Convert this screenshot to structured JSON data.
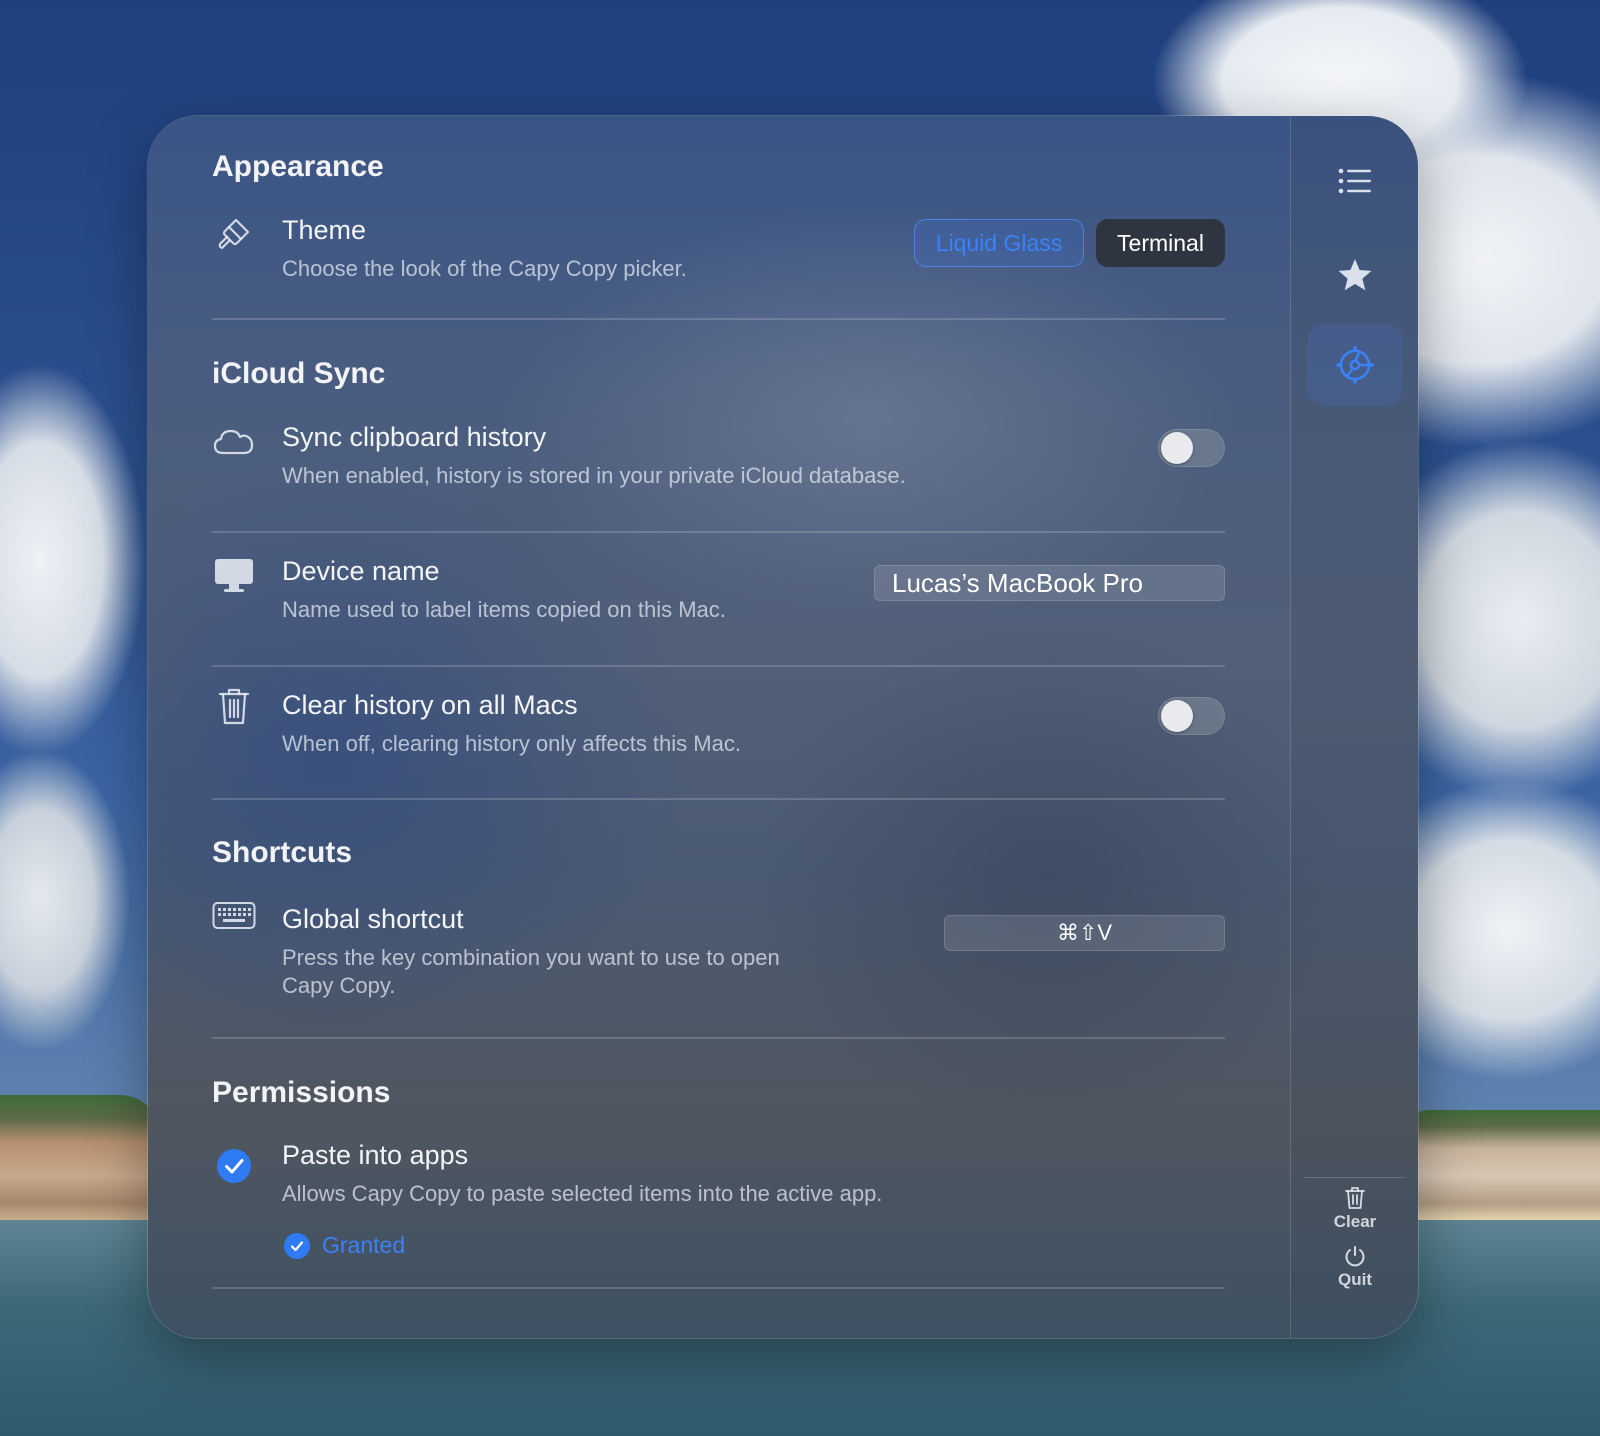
{
  "sections": {
    "appearance": {
      "title": "Appearance",
      "theme": {
        "title": "Theme",
        "description": "Choose the look of the Capy Copy picker.",
        "options": [
          "Liquid Glass",
          "Terminal"
        ],
        "selected": "Liquid Glass"
      }
    },
    "icloud": {
      "title": "iCloud Sync",
      "sync": {
        "title": "Sync clipboard history",
        "description": "When enabled, history is stored in your private iCloud database.",
        "enabled": false
      },
      "device": {
        "title": "Device name",
        "description": "Name used to label items copied on this Mac.",
        "value": "Lucas’s MacBook Pro"
      },
      "clear_all": {
        "title": "Clear history on all Macs",
        "description": "When off, clearing history only affects this Mac.",
        "enabled": false
      }
    },
    "shortcuts": {
      "title": "Shortcuts",
      "global": {
        "title": "Global shortcut",
        "description_line1": "Press the key combination you want to use to open",
        "description_line2": "Capy Copy.",
        "value": "⌘⇧V"
      }
    },
    "permissions": {
      "title": "Permissions",
      "paste": {
        "title": "Paste into apps",
        "description": "Allows Capy Copy to paste selected items into the active app.",
        "status": "Granted"
      }
    }
  },
  "sidebar": {
    "items": [
      {
        "icon": "list-icon",
        "active": false
      },
      {
        "icon": "star-icon",
        "active": false
      },
      {
        "icon": "gear-icon",
        "active": true
      }
    ],
    "clear_label": "Clear",
    "quit_label": "Quit"
  },
  "colors": {
    "accent": "#3b82f6",
    "granted": "#2f7bf5"
  }
}
